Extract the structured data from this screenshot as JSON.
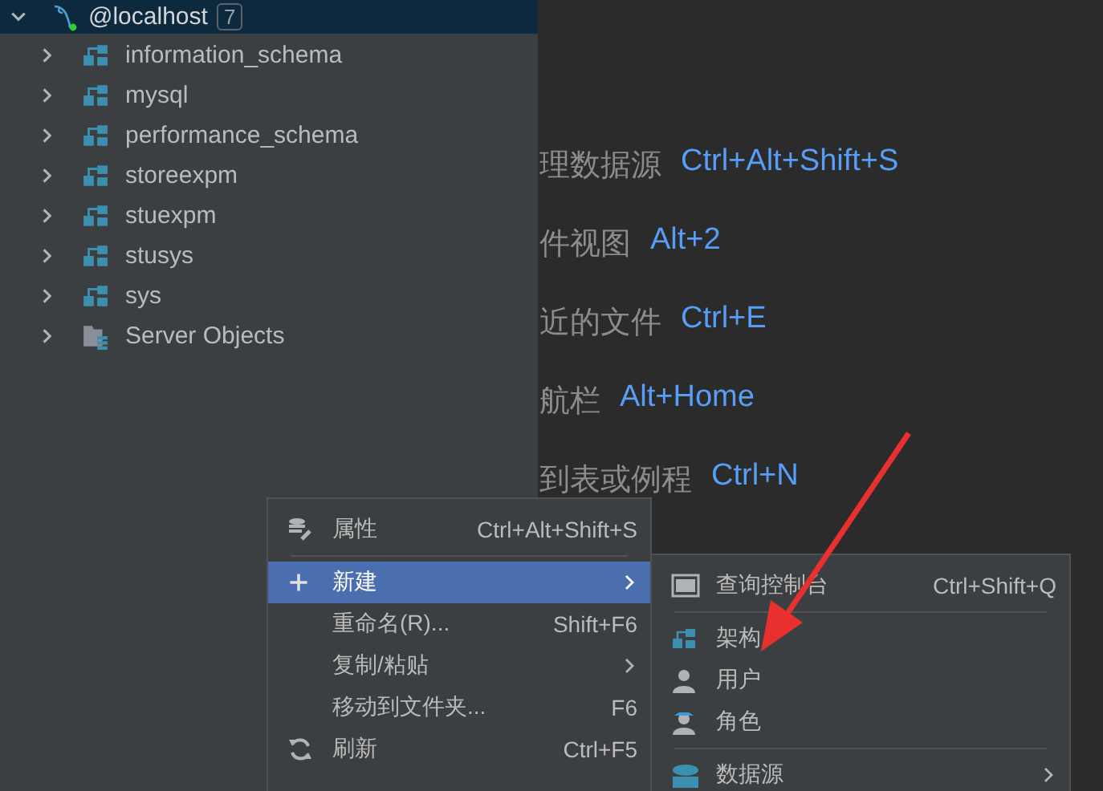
{
  "tree": {
    "root": {
      "label": "@localhost",
      "count": "7",
      "expanded": true
    },
    "items": [
      {
        "label": "information_schema",
        "kind": "schema"
      },
      {
        "label": "mysql",
        "kind": "schema"
      },
      {
        "label": "performance_schema",
        "kind": "schema"
      },
      {
        "label": "storeexpm",
        "kind": "schema"
      },
      {
        "label": "stuexpm",
        "kind": "schema"
      },
      {
        "label": "stusys",
        "kind": "schema"
      },
      {
        "label": "sys",
        "kind": "schema"
      },
      {
        "label": "Server Objects",
        "kind": "folder"
      }
    ]
  },
  "hints": [
    {
      "label": "理数据源",
      "shortcut": "Ctrl+Alt+Shift+S"
    },
    {
      "label": "件视图",
      "shortcut": "Alt+2"
    },
    {
      "label": "近的文件",
      "shortcut": "Ctrl+E"
    },
    {
      "label": "航栏",
      "shortcut": "Alt+Home"
    },
    {
      "label": "到表或例程",
      "shortcut": "Ctrl+N"
    }
  ],
  "context_menu": {
    "items": [
      {
        "label": "属性",
        "shortcut": "Ctrl+Alt+Shift+S",
        "submenu": false,
        "selected": false,
        "separator_after": true
      },
      {
        "label": "新建",
        "submenu": true,
        "selected": true,
        "separator_after": false
      },
      {
        "label": "重命名(R)...",
        "shortcut": "Shift+F6",
        "submenu": false,
        "selected": false,
        "separator_after": false
      },
      {
        "label": "复制/粘贴",
        "submenu": true,
        "selected": false,
        "separator_after": false
      },
      {
        "label": "移动到文件夹...",
        "shortcut": "F6",
        "submenu": false,
        "selected": false,
        "separator_after": false
      },
      {
        "label": "刷新",
        "shortcut": "Ctrl+F5",
        "submenu": false,
        "selected": false,
        "separator_after": false
      }
    ]
  },
  "submenu": {
    "items": [
      {
        "label": "查询控制台",
        "shortcut": "Ctrl+Shift+Q",
        "submenu": false,
        "separator_after": true
      },
      {
        "label": "架构",
        "submenu": false,
        "separator_after": false
      },
      {
        "label": "用户",
        "submenu": false,
        "separator_after": false
      },
      {
        "label": "角色",
        "submenu": false,
        "separator_after": true
      },
      {
        "label": "数据源",
        "submenu": true,
        "separator_after": false
      }
    ]
  }
}
